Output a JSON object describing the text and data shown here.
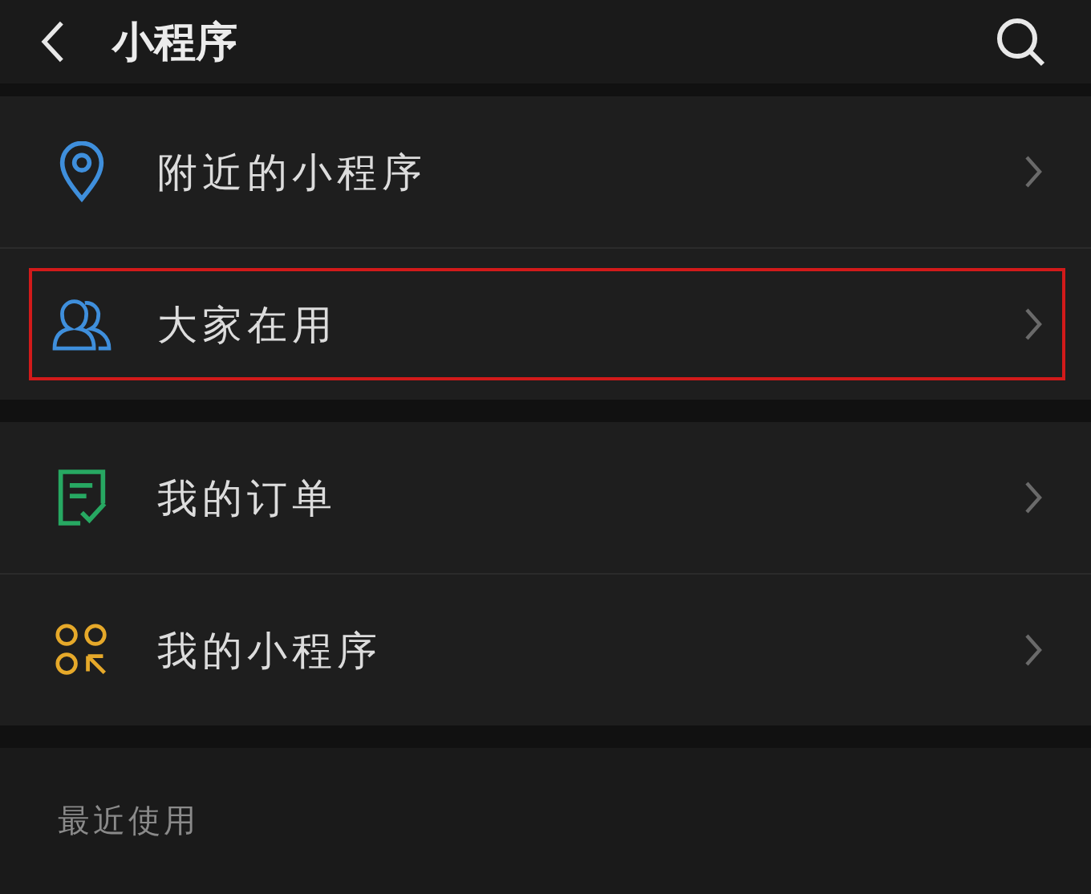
{
  "header": {
    "title": "小程序"
  },
  "groups": [
    {
      "items": [
        {
          "kind": "pin",
          "label": "附近的小程序",
          "color": "#3f8fdc",
          "highlighted": false
        },
        {
          "kind": "people",
          "label": "大家在用",
          "color": "#3f8fdc",
          "highlighted": true
        }
      ]
    },
    {
      "items": [
        {
          "kind": "order",
          "label": "我的订单",
          "color": "#27a862",
          "highlighted": false
        },
        {
          "kind": "apps",
          "label": "我的小程序",
          "color": "#e6a92a",
          "highlighted": false
        }
      ]
    }
  ],
  "recent": {
    "title": "最近使用"
  }
}
